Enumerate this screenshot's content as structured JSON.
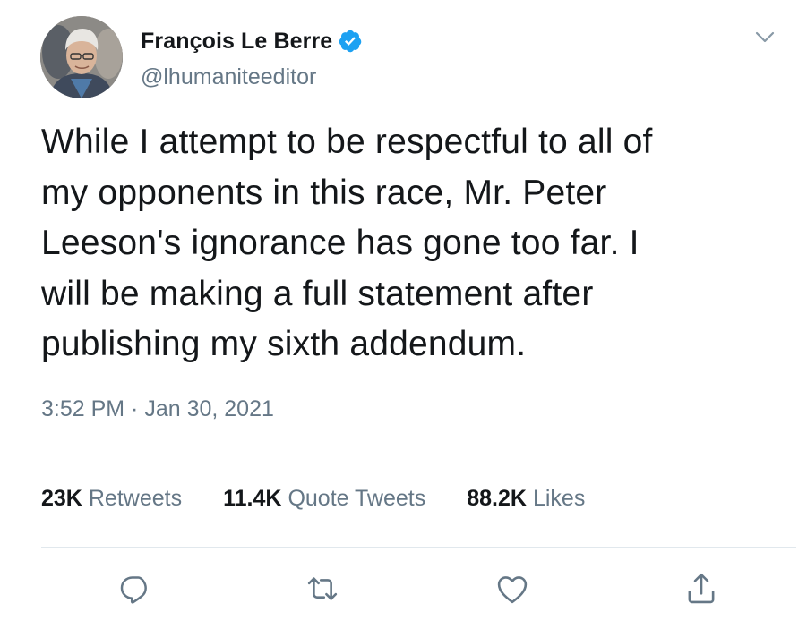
{
  "author": {
    "display_name": "François Le Berre",
    "handle": "@lhumaniteeditor",
    "verified": true,
    "avatar_icon": "profile-photo"
  },
  "tweet": {
    "text": "While I attempt to be respectful to all of my opponents in this race, Mr. Peter Leeson's ignorance has gone too far. I will be making a full statement after publishing my sixth addendum.",
    "lines": [
      "While I attempt to be respectful to all of",
      "my opponents in this race, Mr. Peter",
      "Leeson's ignorance has gone too far. I",
      "will be making a full statement after",
      "publishing my sixth addendum."
    ],
    "timestamp": "3:52 PM · Jan 30, 2021"
  },
  "stats": {
    "retweets": {
      "count": "23K",
      "label": "Retweets"
    },
    "quotes": {
      "count": "11.4K",
      "label": "Quote Tweets"
    },
    "likes": {
      "count": "88.2K",
      "label": "Likes"
    }
  },
  "actions": [
    {
      "name": "reply",
      "icon": "speech-bubble-icon"
    },
    {
      "name": "retweet",
      "icon": "retweet-arrows-icon"
    },
    {
      "name": "like",
      "icon": "heart-icon"
    },
    {
      "name": "share",
      "icon": "share-upload-icon"
    }
  ],
  "colors": {
    "text_primary": "#14171a",
    "text_secondary": "#657786",
    "verified_blue": "#1da1f2",
    "divider": "#e1e8ed"
  }
}
